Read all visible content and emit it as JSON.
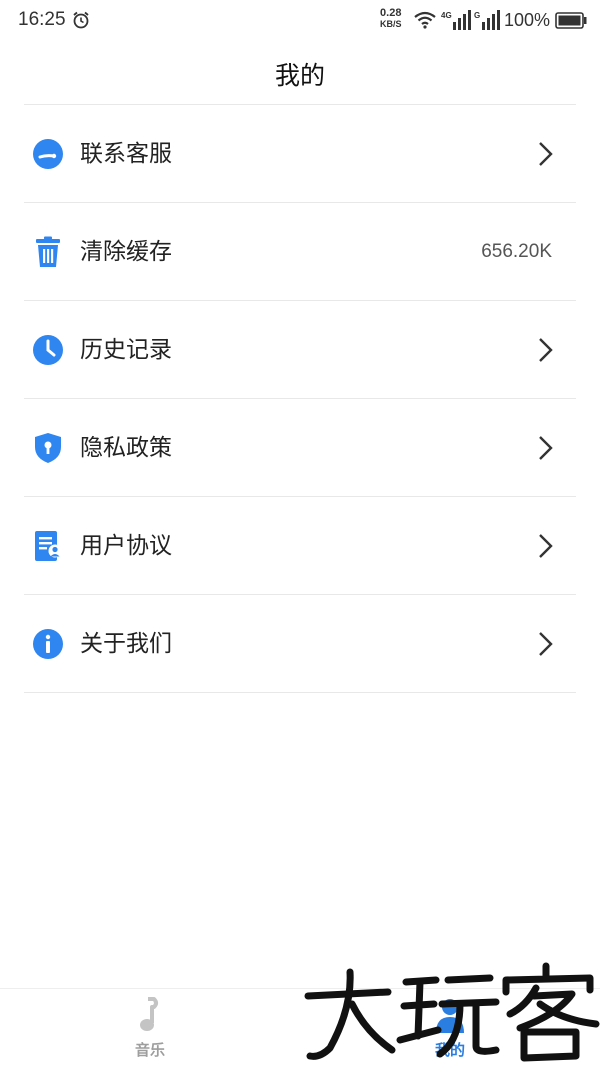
{
  "status_bar": {
    "time": "16:25",
    "net_speed_value": "0.28",
    "net_speed_unit": "KB/S",
    "net_type": "4G",
    "net_type2": "G",
    "battery": "100%"
  },
  "header": {
    "title": "我的"
  },
  "menu": [
    {
      "label": "联系客服",
      "icon": "customer-service-icon",
      "trailing": "chevron"
    },
    {
      "label": "清除缓存",
      "icon": "trash-icon",
      "trailing": "value",
      "value": "656.20K"
    },
    {
      "label": "历史记录",
      "icon": "clock-icon",
      "trailing": "chevron"
    },
    {
      "label": "隐私政策",
      "icon": "shield-lock-icon",
      "trailing": "chevron"
    },
    {
      "label": "用户协议",
      "icon": "document-user-icon",
      "trailing": "chevron"
    },
    {
      "label": "关于我们",
      "icon": "info-icon",
      "trailing": "chevron"
    }
  ],
  "bottom_nav": {
    "tabs": [
      {
        "label": "音乐",
        "icon": "music-note-icon",
        "active": false
      },
      {
        "label": "我的",
        "icon": "person-icon",
        "active": true
      }
    ]
  },
  "watermark": {
    "text": "大玩客"
  },
  "colors": {
    "accent": "#2a7de1",
    "icon_blue": "#2f86f0",
    "divider": "#e8e8e8",
    "inactive": "#9e9e9e"
  }
}
